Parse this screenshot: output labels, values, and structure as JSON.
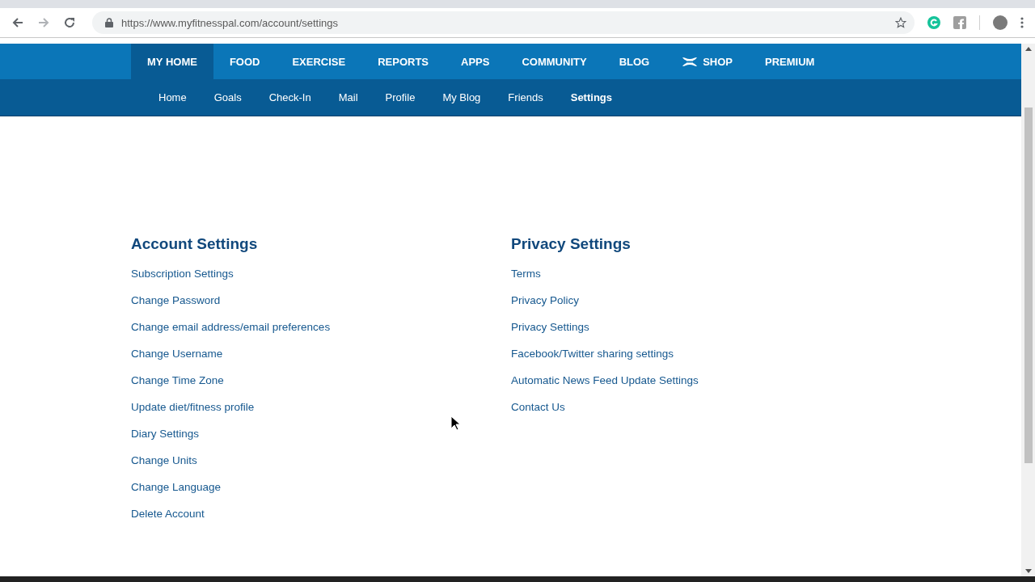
{
  "browser": {
    "url": "https://www.myfitnesspal.com/account/settings"
  },
  "main_nav": [
    {
      "label": "MY HOME",
      "selected": true,
      "kind": "text"
    },
    {
      "label": "FOOD",
      "selected": false,
      "kind": "text"
    },
    {
      "label": "EXERCISE",
      "selected": false,
      "kind": "text"
    },
    {
      "label": "REPORTS",
      "selected": false,
      "kind": "text"
    },
    {
      "label": "APPS",
      "selected": false,
      "kind": "text"
    },
    {
      "label": "COMMUNITY",
      "selected": false,
      "kind": "text"
    },
    {
      "label": "BLOG",
      "selected": false,
      "kind": "text"
    },
    {
      "label": "SHOP",
      "selected": false,
      "kind": "icon"
    },
    {
      "label": "PREMIUM",
      "selected": false,
      "kind": "text"
    }
  ],
  "sub_nav": [
    {
      "label": "Home",
      "selected": false
    },
    {
      "label": "Goals",
      "selected": false
    },
    {
      "label": "Check-In",
      "selected": false
    },
    {
      "label": "Mail",
      "selected": false
    },
    {
      "label": "Profile",
      "selected": false
    },
    {
      "label": "My Blog",
      "selected": false
    },
    {
      "label": "Friends",
      "selected": false
    },
    {
      "label": "Settings",
      "selected": true
    }
  ],
  "sections": [
    {
      "title": "Account Settings",
      "links": [
        "Subscription Settings",
        "Change Password",
        "Change email address/email preferences",
        "Change Username",
        "Change Time Zone",
        "Update diet/fitness profile",
        "Diary Settings",
        "Change Units",
        "Change Language",
        "Delete Account"
      ]
    },
    {
      "title": "Privacy Settings",
      "links": [
        "Terms",
        "Privacy Policy",
        "Privacy Settings",
        "Facebook/Twitter sharing settings",
        "Automatic News Feed Update Settings",
        "Contact Us"
      ]
    }
  ]
}
